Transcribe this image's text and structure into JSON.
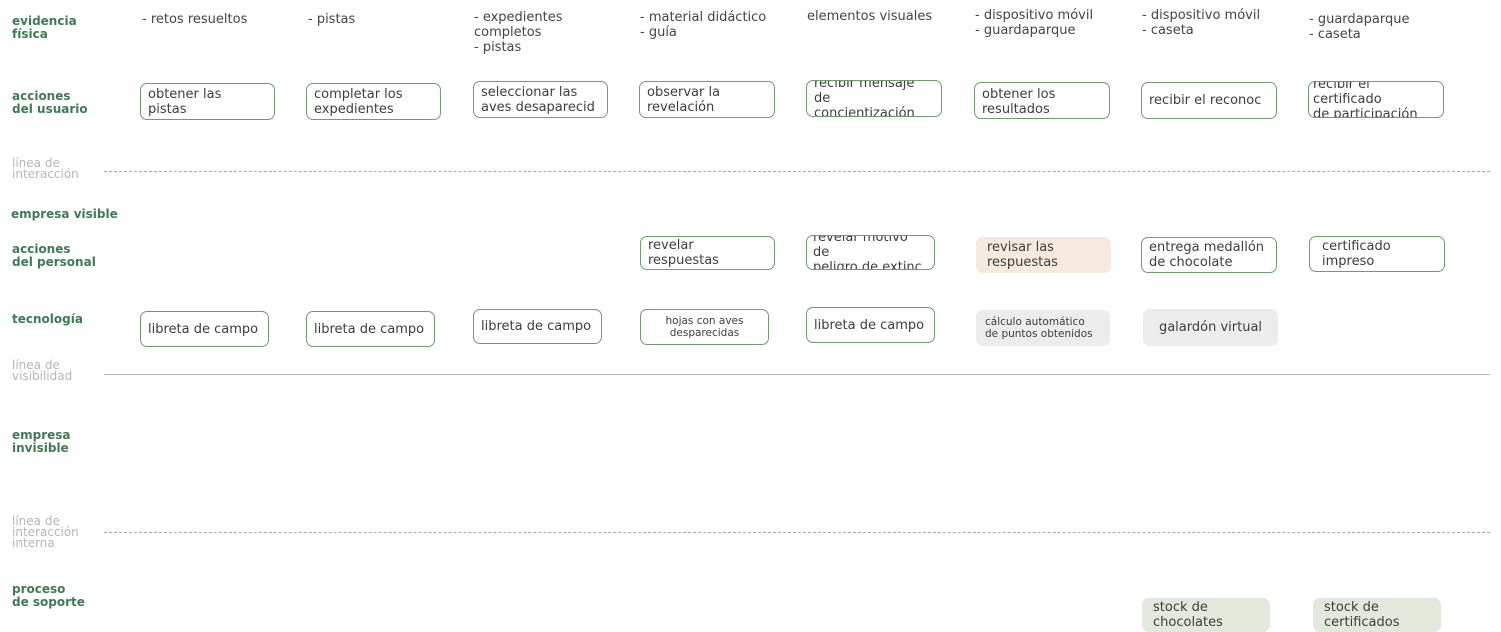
{
  "row_labels": {
    "evidencia": "evidencia\nfísica",
    "acciones_usuario": "acciones\ndel usuario",
    "linea_interaccion": "línea de\ninteracción",
    "empresa_visible": "empresa visible",
    "acciones_personal": "acciones\ndel personal",
    "tecnologia": "tecnología",
    "linea_visibilidad": "línea de\nvisibilidad",
    "empresa_invisible": "empresa\ninvisible",
    "linea_interaccion_interna": "línea de\ninteracción\ninterna",
    "proceso_soporte": "proceso\nde soporte"
  },
  "evidencia": [
    "- retos resueltos",
    "- pistas",
    "- expedientes\ncompletos\n- pistas",
    "- material didáctico\n- guía",
    "elementos visuales",
    "- dispositivo móvil\n- guardaparque",
    "- dispositivo móvil\n- caseta",
    "- guardaparque\n- caseta"
  ],
  "acciones_usuario": [
    "obtener las\npistas",
    "completar los\nexpedientes",
    "seleccionar las\naves desaparecid",
    "observar la\nrevelación",
    "recibir mensaje de\nconcientización",
    "obtener los\nresultados",
    "recibir el reconoc",
    "recibir el certificado\nde participación"
  ],
  "acciones_personal": [
    "revelar respuestas",
    "revelar motivo de\npeligro de extinc",
    "revisar las\nrespuestas",
    "entrega medallón\nde chocolate",
    "certificado\nimpreso"
  ],
  "tecnologia": [
    "libreta de campo",
    "libreta de campo",
    "libreta de campo",
    "hojas con aves\ndesparecidas",
    "libreta de campo",
    "cálculo automático\nde puntos obtenidos",
    "galardón virtual"
  ],
  "soporte": [
    "stock de\nchocolates",
    "stock de\ncertificados"
  ],
  "colors": {
    "label_green": "#3f7a55",
    "box_border": "#6f9a72",
    "beige_fill": "#f5eadd",
    "gray_fill": "#ececed",
    "green_fill": "#e2e8dc",
    "muted_label": "#b6b6b6"
  }
}
